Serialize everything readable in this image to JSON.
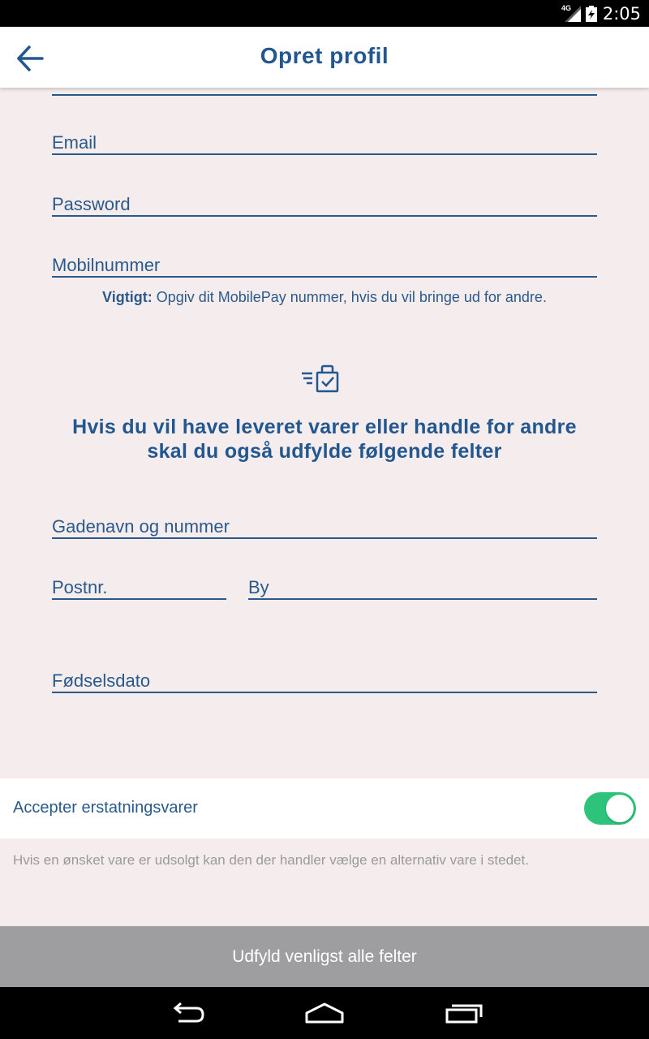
{
  "status_bar": {
    "network": "4G",
    "time": "2:05",
    "icons": [
      "signal-icon",
      "battery-charging-icon"
    ]
  },
  "header": {
    "title": "Opret profil",
    "back_icon": "arrow-left-icon"
  },
  "form": {
    "email": {
      "placeholder": "Email",
      "value": ""
    },
    "password": {
      "placeholder": "Password",
      "value": ""
    },
    "mobile": {
      "placeholder": "Mobilnummer",
      "value": ""
    },
    "mobile_note": {
      "bold": "Vigtigt:",
      "text": " Opgiv dit MobilePay nummer, hvis du vil bringe ud for andre."
    },
    "delivery_section": {
      "icon": "delivery-bag-icon",
      "heading_line1": "Hvis du vil have leveret varer eller handle for andre",
      "heading_line2": "skal du også udfylde følgende felter"
    },
    "street": {
      "placeholder": "Gadenavn og nummer",
      "value": ""
    },
    "postal": {
      "placeholder": "Postnr.",
      "value": ""
    },
    "city": {
      "placeholder": "By",
      "value": ""
    },
    "birthdate": {
      "placeholder": "Fødselsdato",
      "value": ""
    }
  },
  "substitution": {
    "label": "Accepter erstatningsvarer",
    "enabled": true,
    "help": "Hvis en ønsket vare er udsolgt kan den der handler vælge en alternativ vare i stedet.",
    "toggle_color": "#2dc37a"
  },
  "submit": {
    "label": "Udfyld venligst alle felter"
  },
  "nav_bar": {
    "icons": [
      "back-nav-icon",
      "home-nav-icon",
      "recents-nav-icon"
    ]
  },
  "colors": {
    "accent": "#2a5a8c",
    "background": "#f5eced",
    "button_disabled": "#9e9d9f"
  }
}
